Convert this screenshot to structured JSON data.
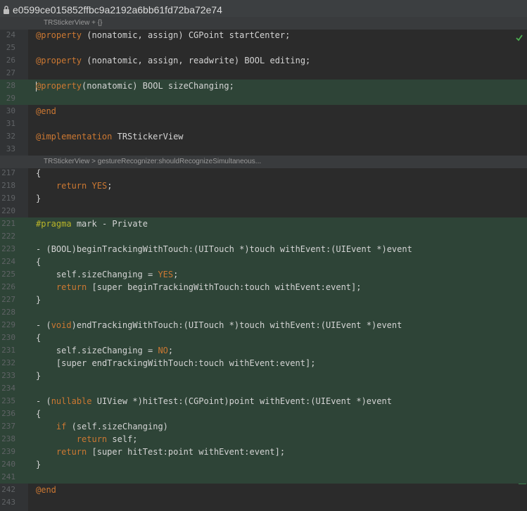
{
  "window": {
    "title": "e0599ce015852ffbc9a2192a6bb61fd72ba72e74"
  },
  "breadcrumbs": [
    "TRStickerView + {}",
    "TRStickerView > gestureRecognizer:shouldRecognizeSimultaneous..."
  ],
  "lines_top": [
    {
      "num": "24",
      "text": "@property (nonatomic, assign) CGPoint startCenter;"
    },
    {
      "num": "25",
      "text": ""
    },
    {
      "num": "26",
      "text": "@property (nonatomic, assign, readwrite) BOOL editing;"
    },
    {
      "num": "27",
      "text": ""
    },
    {
      "num": "28",
      "text": "@property(nonatomic) BOOL sizeChanging;"
    },
    {
      "num": "29",
      "text": ""
    },
    {
      "num": "30",
      "text": "@end"
    },
    {
      "num": "31",
      "text": ""
    },
    {
      "num": "32",
      "text": "@implementation TRStickerView"
    },
    {
      "num": "33",
      "text": ""
    }
  ],
  "lines_bottom": [
    {
      "num": "217",
      "text": "{"
    },
    {
      "num": "218",
      "text": "    return YES;"
    },
    {
      "num": "219",
      "text": "}"
    },
    {
      "num": "220",
      "text": ""
    },
    {
      "num": "221",
      "text": "#pragma mark - Private"
    },
    {
      "num": "222",
      "text": ""
    },
    {
      "num": "223",
      "text": "- (BOOL)beginTrackingWithTouch:(UITouch *)touch withEvent:(UIEvent *)event"
    },
    {
      "num": "224",
      "text": "{"
    },
    {
      "num": "225",
      "text": "    self.sizeChanging = YES;"
    },
    {
      "num": "226",
      "text": "    return [super beginTrackingWithTouch:touch withEvent:event];"
    },
    {
      "num": "227",
      "text": "}"
    },
    {
      "num": "228",
      "text": ""
    },
    {
      "num": "229",
      "text": "- (void)endTrackingWithTouch:(UITouch *)touch withEvent:(UIEvent *)event"
    },
    {
      "num": "230",
      "text": "{"
    },
    {
      "num": "231",
      "text": "    self.sizeChanging = NO;"
    },
    {
      "num": "232",
      "text": "    [super endTrackingWithTouch:touch withEvent:event];"
    },
    {
      "num": "233",
      "text": "}"
    },
    {
      "num": "234",
      "text": ""
    },
    {
      "num": "235",
      "text": "- (nullable UIView *)hitTest:(CGPoint)point withEvent:(UIEvent *)event"
    },
    {
      "num": "236",
      "text": "{"
    },
    {
      "num": "237",
      "text": "    if (self.sizeChanging)"
    },
    {
      "num": "238",
      "text": "        return self;"
    },
    {
      "num": "239",
      "text": "    return [super hitTest:point withEvent:event];"
    },
    {
      "num": "240",
      "text": "}"
    },
    {
      "num": "241",
      "text": ""
    },
    {
      "num": "242",
      "text": "@end"
    },
    {
      "num": "243",
      "text": ""
    }
  ],
  "highlighted_lines": [
    "28",
    "29",
    "221",
    "222",
    "223",
    "224",
    "225",
    "226",
    "227",
    "228",
    "229",
    "230",
    "231",
    "232",
    "233",
    "234",
    "235",
    "236",
    "237",
    "238",
    "239",
    "240",
    "241"
  ],
  "caret_line": "28",
  "colors": {
    "background": "#2b2b2b",
    "gutter": "#313335",
    "changed_line": "#2e4437",
    "change_marker": "#3f7f50",
    "keyword": "#cc7832",
    "directive": "#bbb529",
    "text": "#d4d4d4"
  },
  "icons": {
    "title": "lock-icon",
    "status": "check-icon"
  }
}
